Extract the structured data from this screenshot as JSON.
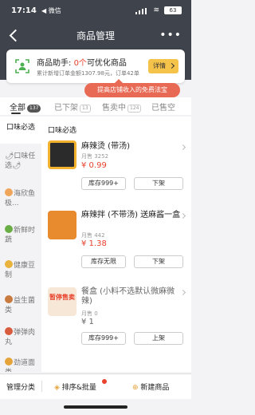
{
  "status": {
    "time": "17:14",
    "location_label": "◀ 微信",
    "battery": "63"
  },
  "nav": {
    "title": "商品管理"
  },
  "assistant": {
    "title_prefix": "商品助手:",
    "count": "0个",
    "title_suffix": "可优化商品",
    "stats": "累计新增订单金额1307.98元，订单42单",
    "detail_label": "详情"
  },
  "promo": {
    "text": "提高店铺收入的免费法宝"
  },
  "tabs": [
    {
      "label": "全部",
      "count": "137"
    },
    {
      "label": "已下架",
      "count": "13"
    },
    {
      "label": "售卖中",
      "count": "124"
    },
    {
      "label": "已售空",
      "count": ""
    }
  ],
  "sidebar": {
    "items": [
      {
        "label": "口味必选",
        "icon": "none",
        "color": ""
      },
      {
        "label": "🌶口味任选🌶",
        "icon": "pepper-icon",
        "color": "#d8452f"
      },
      {
        "label": "海欣鱼极...",
        "icon": "fish-icon",
        "color": "#f0a65a"
      },
      {
        "label": "新鲜时蔬",
        "icon": "vegetable-icon",
        "color": "#6aad45"
      },
      {
        "label": "健康豆制",
        "icon": "tofu-icon",
        "color": "#e9b33d"
      },
      {
        "label": "益生菌类",
        "icon": "mushroom-icon",
        "color": "#c97a3f"
      },
      {
        "label": "弹弹肉丸",
        "icon": "meatball-icon",
        "color": "#d75b3c"
      },
      {
        "label": "劲道面类",
        "icon": "noodle-icon",
        "color": "#e5a33a"
      }
    ]
  },
  "content": {
    "section_title": "口味必选",
    "products": [
      {
        "name": "麻辣烫 (带汤)",
        "sales": "月售 3252",
        "price": "¥ 0.99",
        "stock": "库存999+",
        "action": "下架",
        "thumb_color": "#2b2b2b"
      },
      {
        "name": "麻辣拌 (不带汤) 送麻酱一盒",
        "sales": "月售 442",
        "price": "¥ 1.38",
        "stock": "库存无限",
        "action": "下架",
        "thumb_color": "#e88a2e"
      },
      {
        "name": "餐盒 (小料不选默认微麻微辣)",
        "sales": "月售 0",
        "price": "¥ 1",
        "stock": "库存999+",
        "action": "上架",
        "thumb_color": "#f6e7d6",
        "thumb_text": "暂停售卖"
      }
    ]
  },
  "bottombar": {
    "manage_label": "管理分类",
    "sort_label": "排序&批量",
    "new_label": "新建商品"
  }
}
